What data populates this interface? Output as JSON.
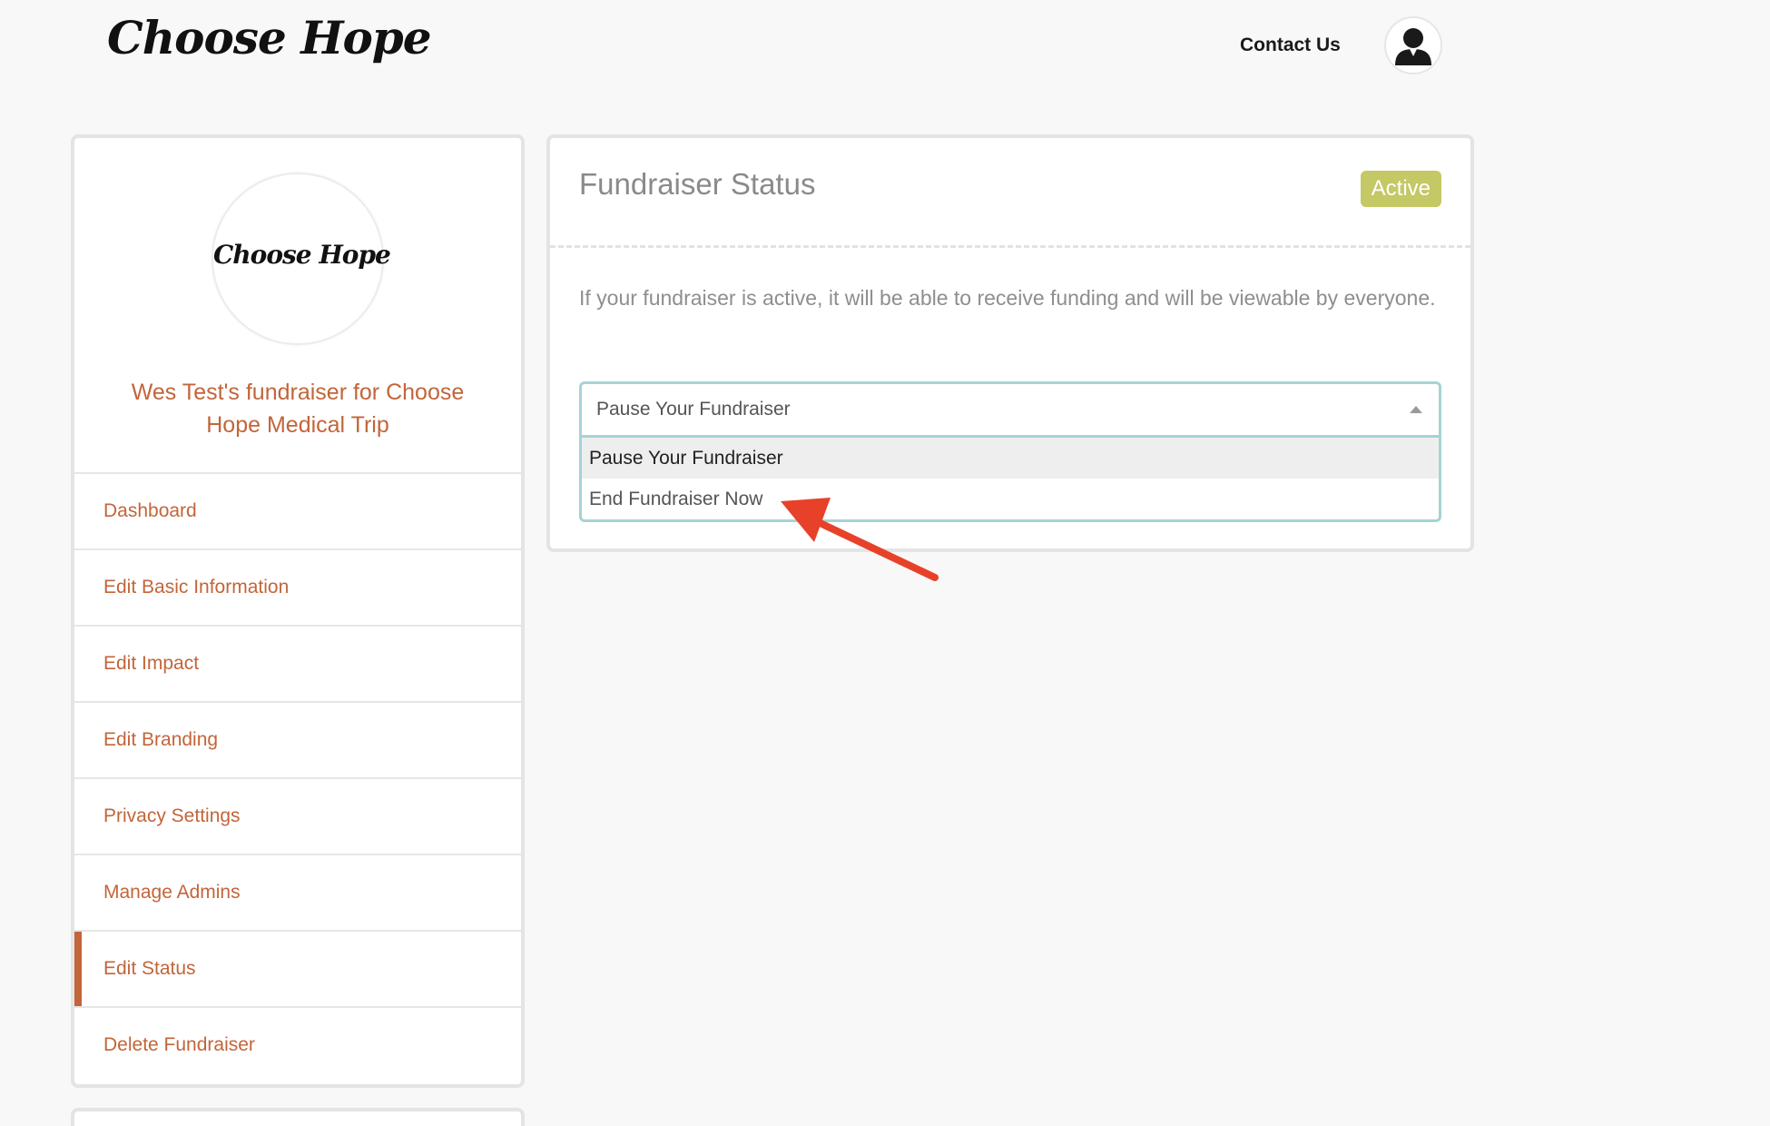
{
  "header": {
    "logo_text": "Choose Hope",
    "contact_label": "Contact Us"
  },
  "sidebar": {
    "logo_text": "Choose Hope",
    "fundraiser_title": "Wes Test's fundraiser for Choose Hope Medical Trip",
    "items": [
      {
        "label": "Dashboard"
      },
      {
        "label": "Edit Basic Information"
      },
      {
        "label": "Edit Impact"
      },
      {
        "label": "Edit Branding"
      },
      {
        "label": "Privacy Settings"
      },
      {
        "label": "Manage Admins"
      },
      {
        "label": "Edit Status",
        "active": true
      },
      {
        "label": "Delete Fundraiser"
      }
    ]
  },
  "status_panel": {
    "title": "Fundraiser Status",
    "badge": "Active",
    "description": "If your fundraiser is active, it will be able to receive funding and will be viewable by everyone.",
    "select": {
      "selected": "Pause Your Fundraiser",
      "options": [
        "Pause Your Fundraiser",
        "End Fundraiser Now"
      ]
    }
  },
  "colors": {
    "accent": "#c2653a",
    "badge": "#c4c865",
    "select_border": "#a6d3d5",
    "arrow": "#e8412a"
  }
}
